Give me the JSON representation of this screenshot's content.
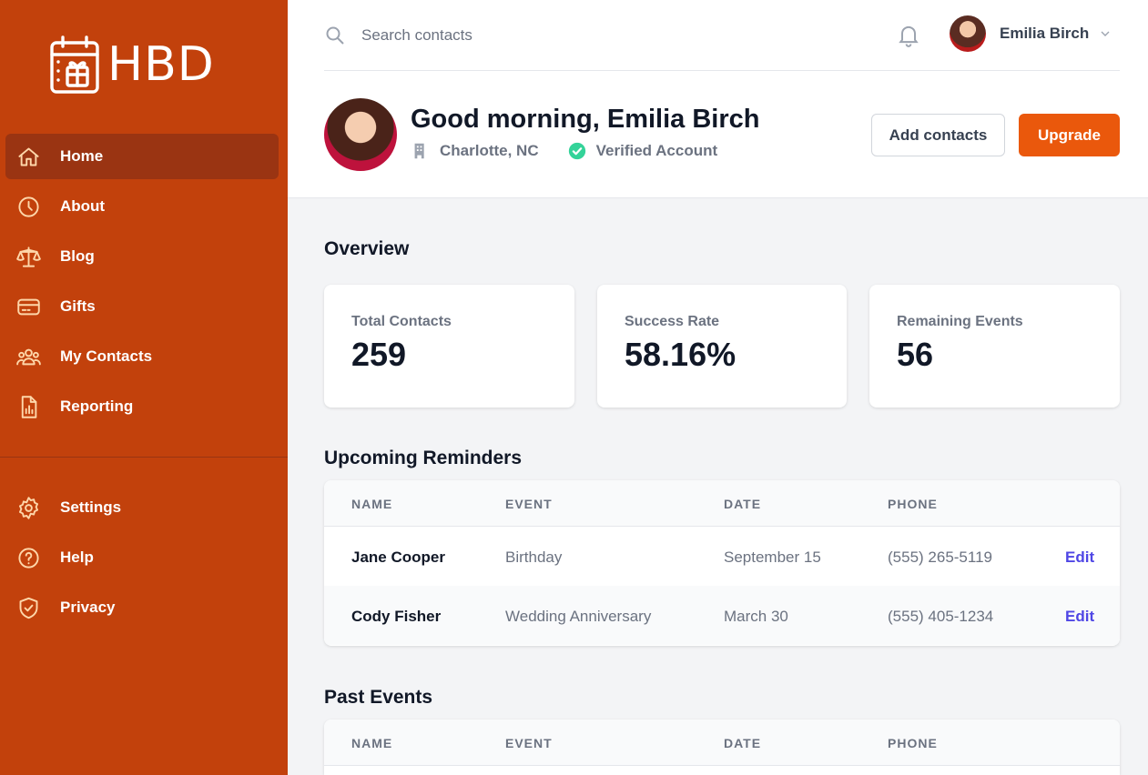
{
  "app": {
    "logo_text": "HBD"
  },
  "sidebar": {
    "items": [
      {
        "label": "Home",
        "icon": "home-icon"
      },
      {
        "label": "About",
        "icon": "clock-icon"
      },
      {
        "label": "Blog",
        "icon": "scale-icon"
      },
      {
        "label": "Gifts",
        "icon": "credit-card-icon"
      },
      {
        "label": "My Contacts",
        "icon": "user-group-icon"
      },
      {
        "label": "Reporting",
        "icon": "document-chart-icon"
      }
    ],
    "secondary": [
      {
        "label": "Settings",
        "icon": "gear-icon"
      },
      {
        "label": "Help",
        "icon": "question-icon"
      },
      {
        "label": "Privacy",
        "icon": "shield-icon"
      }
    ]
  },
  "header": {
    "search_placeholder": "Search contacts",
    "user_name": "Emilia Birch"
  },
  "profile": {
    "greeting": "Good morning, Emilia Birch",
    "location": "Charlotte, NC",
    "verified": "Verified Account",
    "add_contacts": "Add contacts",
    "upgrade": "Upgrade"
  },
  "overview": {
    "title": "Overview",
    "cards": [
      {
        "label": "Total Contacts",
        "value": "259"
      },
      {
        "label": "Success Rate",
        "value": "58.16%"
      },
      {
        "label": "Remaining Events",
        "value": "56"
      }
    ]
  },
  "reminders": {
    "title": "Upcoming Reminders",
    "columns": [
      "NAME",
      "EVENT",
      "DATE",
      "PHONE"
    ],
    "rows": [
      {
        "name": "Jane Cooper",
        "event": "Birthday",
        "date": "September 15",
        "phone": "(555) 265-5119",
        "action": "Edit"
      },
      {
        "name": "Cody Fisher",
        "event": "Wedding Anniversary",
        "date": "March 30",
        "phone": "(555) 405-1234",
        "action": "Edit"
      }
    ]
  },
  "past": {
    "title": "Past Events",
    "columns": [
      "NAME",
      "EVENT",
      "DATE",
      "PHONE"
    ]
  },
  "colors": {
    "sidebar": "#c2410c",
    "active": "#9a3412",
    "primary": "#ea580c",
    "link": "#4f46e5",
    "verified": "#34d399"
  }
}
